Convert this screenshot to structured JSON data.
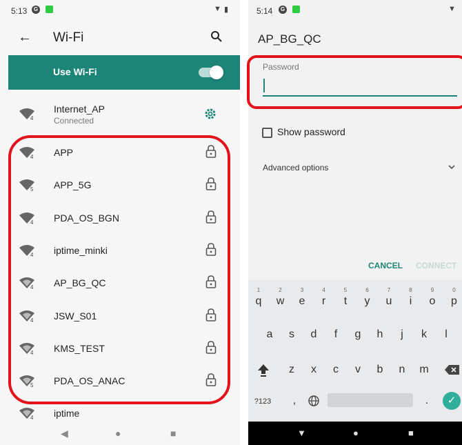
{
  "left": {
    "status": {
      "time": "5:13"
    },
    "appbar": {
      "title": "Wi-Fi"
    },
    "use_wifi": {
      "label": "Use Wi-Fi",
      "enabled": true
    },
    "current": {
      "name": "Internet_AP",
      "status": "Connected",
      "signal_badge": "4"
    },
    "networks": [
      {
        "name": "APP",
        "signal_badge": "4"
      },
      {
        "name": "APP_5G",
        "signal_badge": "5"
      },
      {
        "name": "PDA_OS_BGN",
        "signal_badge": "4"
      },
      {
        "name": "iptime_minki",
        "signal_badge": "4"
      },
      {
        "name": "AP_BG_QC",
        "signal_badge": "4"
      },
      {
        "name": "JSW_S01",
        "signal_badge": "4"
      },
      {
        "name": "KMS_TEST",
        "signal_badge": "4"
      },
      {
        "name": "PDA_OS_ANAC",
        "signal_badge": "5"
      },
      {
        "name": "iptime",
        "signal_badge": "4"
      }
    ]
  },
  "right": {
    "status": {
      "time": "5:14"
    },
    "dialog": {
      "title": "AP_BG_QC",
      "password_label": "Password",
      "password_value": "",
      "show_password": "Show password",
      "advanced": "Advanced options",
      "cancel": "CANCEL",
      "connect": "CONNECT"
    },
    "keyboard": {
      "row1": [
        "q",
        "w",
        "e",
        "r",
        "t",
        "y",
        "u",
        "i",
        "o",
        "p"
      ],
      "row1_hints": [
        "1",
        "2",
        "3",
        "4",
        "5",
        "6",
        "7",
        "8",
        "9",
        "0"
      ],
      "row2": [
        "a",
        "s",
        "d",
        "f",
        "g",
        "h",
        "j",
        "k",
        "l"
      ],
      "row3": [
        "z",
        "x",
        "c",
        "v",
        "b",
        "n",
        "m"
      ],
      "symbols": "?123",
      "comma": ",",
      "period": "."
    }
  },
  "colors": {
    "accent": "#1c8577",
    "highlight": "#e2131b"
  }
}
